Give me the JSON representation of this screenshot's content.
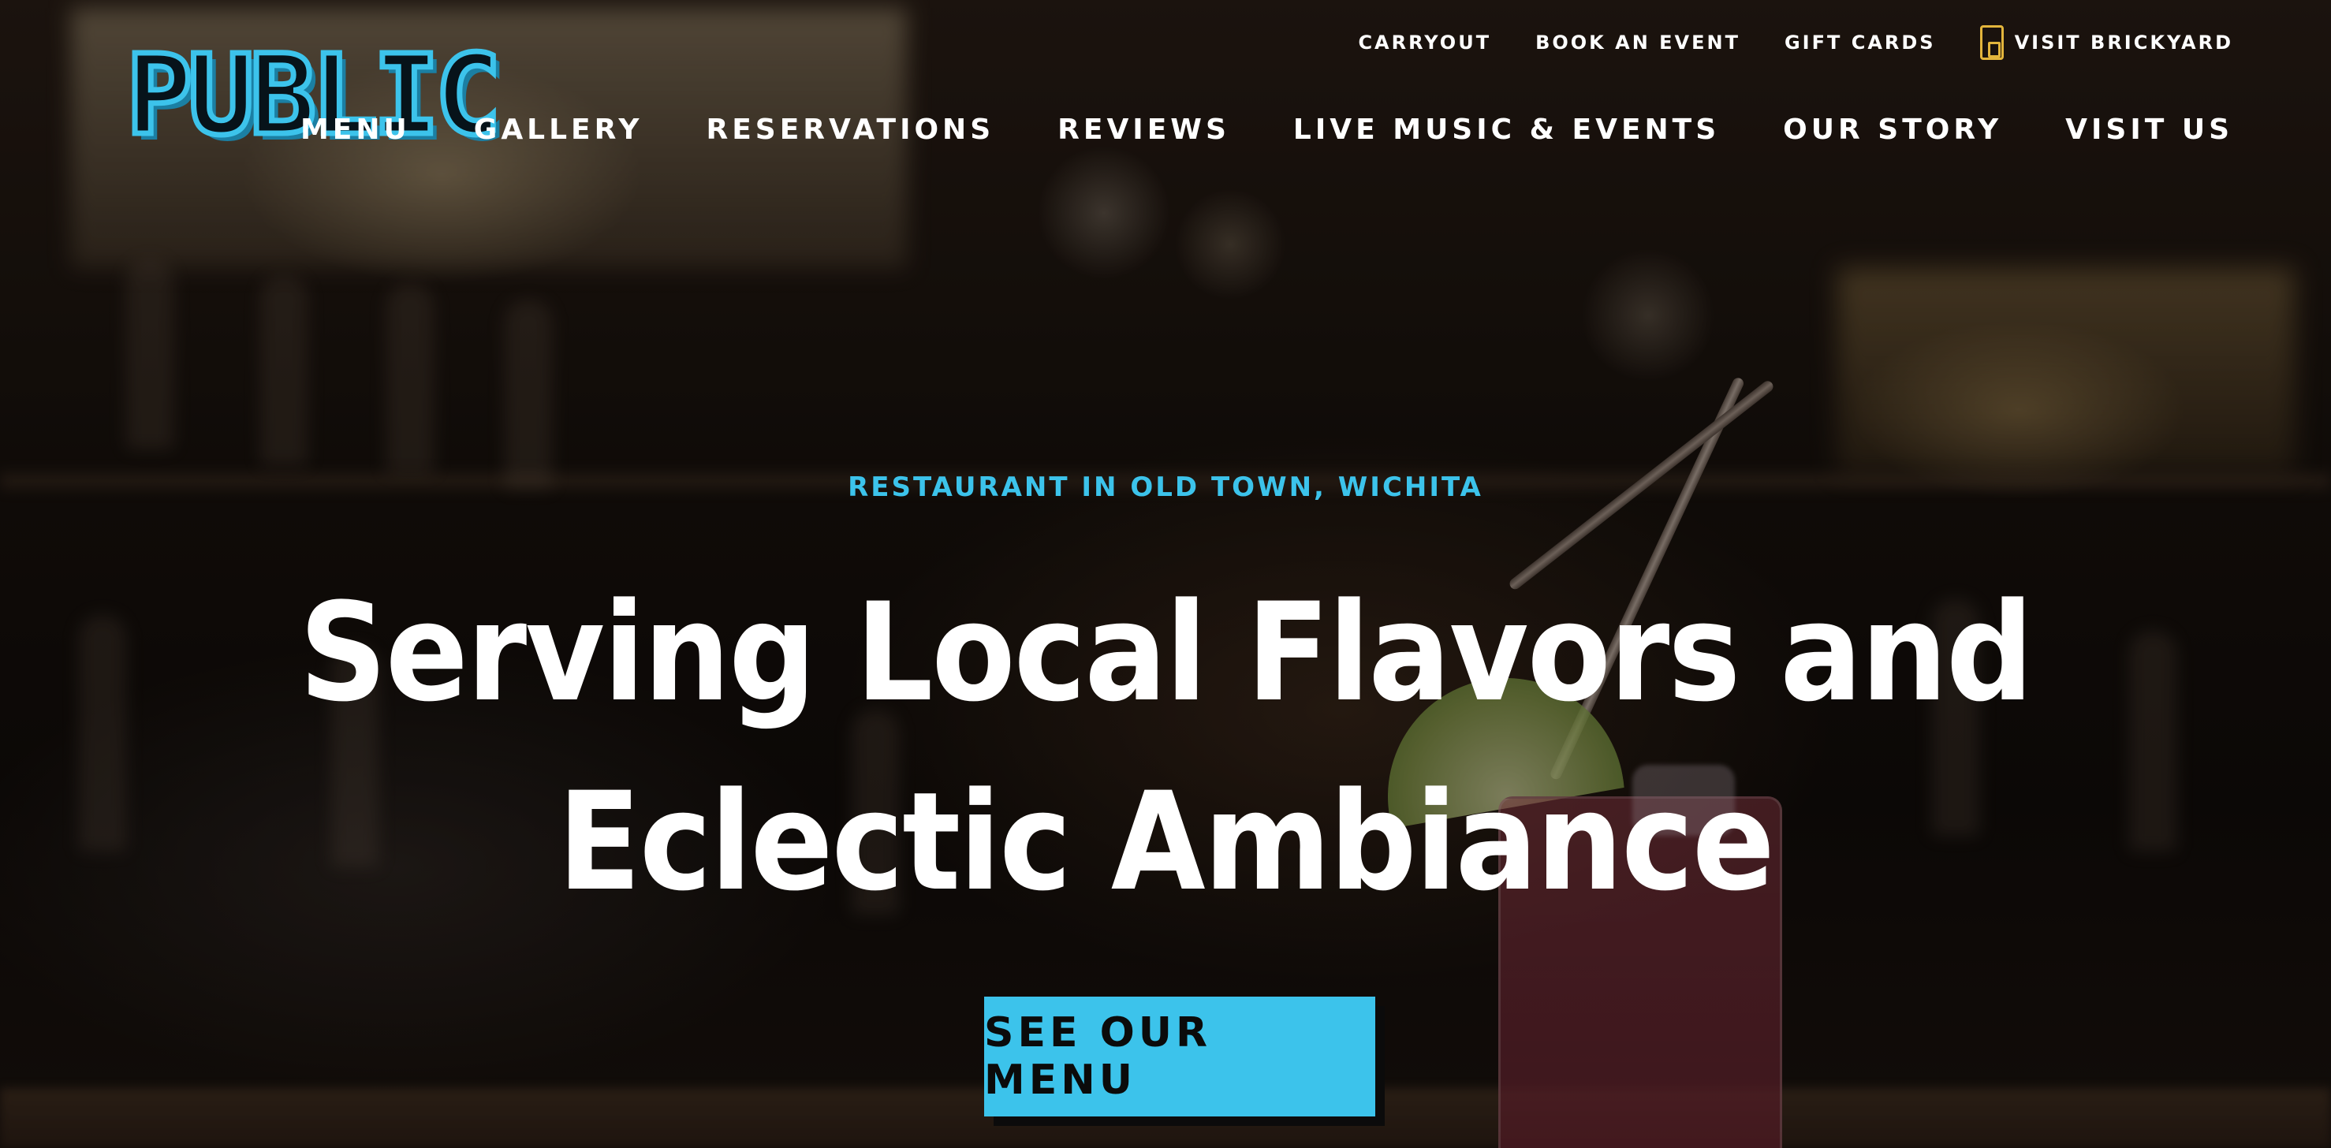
{
  "brand": {
    "logo_text": "PUBLIC",
    "accent_color": "#3cc3eb",
    "icon_color": "#e3b53c"
  },
  "utility_nav": {
    "items": [
      {
        "label": "CARRYOUT"
      },
      {
        "label": "BOOK AN EVENT"
      },
      {
        "label": "GIFT CARDS"
      },
      {
        "label": "VISIT BRICKYARD",
        "icon": "brickyard-logo-icon"
      }
    ]
  },
  "main_nav": {
    "items": [
      {
        "label": "MENU"
      },
      {
        "label": "GALLERY"
      },
      {
        "label": "RESERVATIONS"
      },
      {
        "label": "REVIEWS"
      },
      {
        "label": "LIVE MUSIC & EVENTS"
      },
      {
        "label": "OUR STORY"
      },
      {
        "label": "VISIT US"
      }
    ]
  },
  "hero": {
    "eyebrow": "RESTAURANT IN OLD TOWN, WICHITA",
    "headline_line1": "Serving Local Flavors and",
    "headline_line2": "Eclectic Ambiance",
    "cta_label": "SEE OUR MENU"
  }
}
